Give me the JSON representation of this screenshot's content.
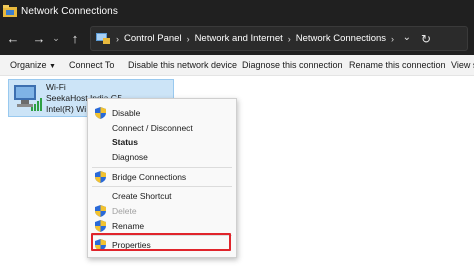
{
  "window": {
    "title": "Network Connections",
    "icon": "network-folder-icon"
  },
  "nav": {
    "back_icon": "arrow-left-icon",
    "forward_icon": "arrow-right-icon",
    "up_icon": "arrow-up-icon",
    "breadcrumb": [
      "Control Panel",
      "Network and Internet",
      "Network Connections"
    ],
    "refresh_icon": "refresh-icon"
  },
  "commands": [
    "Organize",
    "Connect To",
    "Disable this network device",
    "Diagnose this connection",
    "Rename this connection",
    "View s"
  ],
  "adapter": {
    "name": "Wi-Fi",
    "network": "SeekaHost India G5",
    "device": "Intel(R) Wi"
  },
  "context_menu": {
    "disable": "Disable",
    "connect": "Connect / Disconnect",
    "status": "Status",
    "diagnose": "Diagnose",
    "bridge": "Bridge Connections",
    "shortcut": "Create Shortcut",
    "delete": "Delete",
    "rename": "Rename",
    "properties": "Properties"
  },
  "colors": {
    "highlight": "#e0242b",
    "selection": "#cce4f7",
    "titlebar": "#202020"
  }
}
